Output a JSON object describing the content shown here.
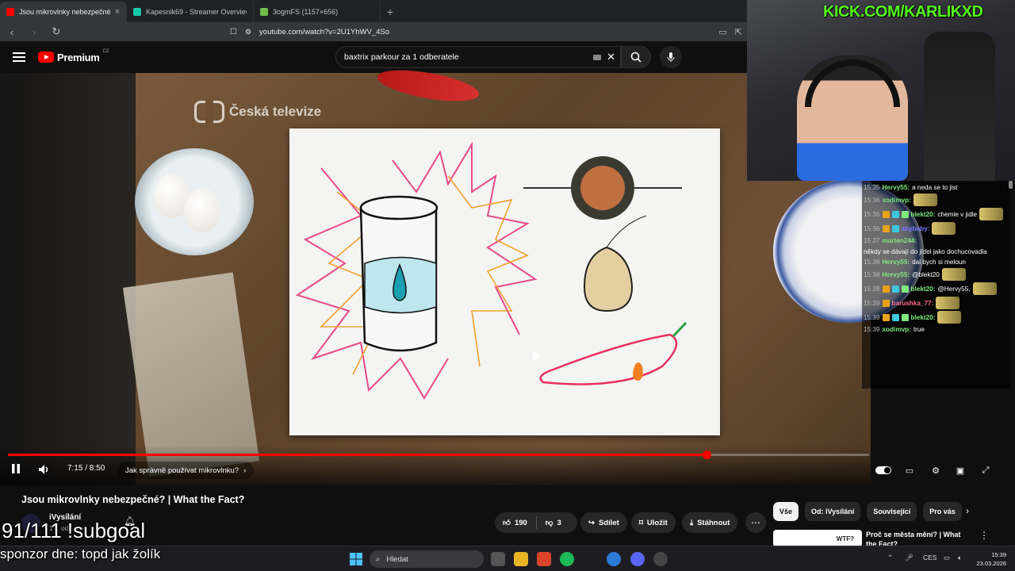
{
  "browser": {
    "tabs": [
      {
        "label": "Jsou mikrovlnky nebezpečné",
        "favicon_color": "#ff0000",
        "active": true
      },
      {
        "label": "Kapesnik69 - Streamer Overview & S",
        "favicon_color": "#14c8a8",
        "active": false
      },
      {
        "label": "3ogmFS (1157×656)",
        "favicon_color": "#6fbf4a",
        "active": false
      }
    ],
    "new_tab": "+",
    "url": "youtube.com/watch?v=2U1YhWV_4So"
  },
  "youtube": {
    "logo_text": "Premium",
    "logo_region": "CZ",
    "search_value": "baxtrix parkour za 1 odberatele",
    "brand_color": "#ff0000"
  },
  "video": {
    "watermark": "Česká televize",
    "time": "7:15 / 8:50",
    "progress_fraction": 0.811,
    "chapter": "Jak správně používat mikrovlnku?",
    "title": "Jsou mikrovlnky nebezpečné? | What the Fact?",
    "channel": "iVysílání",
    "channel_sub": "1 s. od...",
    "likes": "190",
    "dislikes": "3",
    "share": "Sdílet",
    "save": "Uložit",
    "download": "Stáhnout"
  },
  "recommendations": {
    "chips": [
      "Vše",
      "Od: iVysílání",
      "Související",
      "Pro vás"
    ],
    "first_title": "Proč se města mění? | What the Fact?",
    "first_thumb_text": "WTF?"
  },
  "overlay": {
    "kick": "KICK.COM/KARLIKXD",
    "subgoal": "91/111 !subgoal",
    "sponsor": "sponzor dne: topd jak žolík"
  },
  "chat": [
    {
      "time": "15:35",
      "user": "Hervy55:",
      "color": "#7ee87e",
      "msg": "a neda se to jist",
      "badges": 0,
      "emote": false
    },
    {
      "time": "15:36",
      "user": "xodimvp:",
      "color": "#7ee87e",
      "msg": "",
      "badges": 0,
      "emote": true
    },
    {
      "time": "15:36",
      "user": "blekt20:",
      "color": "#7ee87e",
      "msg": "chemie v jidle",
      "badges": 3,
      "emote": true
    },
    {
      "time": "15:36",
      "user": "abybaby:",
      "color": "#7b7bff",
      "msg": "",
      "badges": 2,
      "emote": true
    },
    {
      "time": "15:37",
      "user": "marten244:",
      "color": "#7ee87e",
      "msg": "někdy se dávají do jídel jako dochucovadla",
      "badges": 0,
      "emote": false
    },
    {
      "time": "15:38",
      "user": "Hervy55:",
      "color": "#7ee87e",
      "msg": "dal bych si meloun",
      "badges": 0,
      "emote": false
    },
    {
      "time": "15:38",
      "user": "Hervy55:",
      "color": "#7ee87e",
      "msg": "@blekt20",
      "badges": 0,
      "emote": true
    },
    {
      "time": "15:38",
      "user": "blekt20:",
      "color": "#7ee87e",
      "msg": "@Hervy55,",
      "badges": 3,
      "emote": true
    },
    {
      "time": "15:39",
      "user": "barushka_77:",
      "color": "#ff6b8a",
      "msg": "",
      "badges": 1,
      "emote": true
    },
    {
      "time": "15:39",
      "user": "blekt20:",
      "color": "#7ee87e",
      "msg": "",
      "badges": 3,
      "emote": true
    },
    {
      "time": "15:39",
      "user": "xodimvp:",
      "color": "#7ee87e",
      "msg": "true",
      "badges": 0,
      "emote": false
    }
  ],
  "taskbar": {
    "search": "Hledat",
    "lang": "CES",
    "time": "15:39",
    "date": "23.03.2026"
  }
}
